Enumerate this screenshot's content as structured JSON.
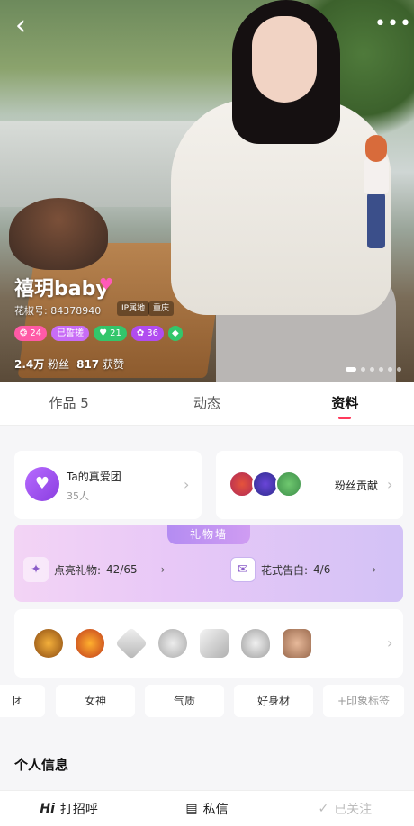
{
  "header": {
    "back_icon": "chevron-left-icon",
    "more_icon": "more-dots-icon"
  },
  "profile": {
    "nickname": "禧玥baby",
    "id_text": "花椒号: 84378940",
    "tags_small": [
      "IP属地",
      "重庆"
    ],
    "badges": [
      {
        "icon": "●",
        "text": "24",
        "color": "#ff5aa6"
      },
      {
        "icon": "",
        "text": "已誓搓",
        "color": "#c86cf6"
      },
      {
        "icon": "●",
        "text": "21",
        "color": "#33c66b"
      },
      {
        "icon": "●",
        "text": "36",
        "color": "#b14cf0"
      },
      {
        "icon": "●",
        "text": "",
        "color": "#33c66b"
      }
    ],
    "fans_count": "2.4万",
    "fans_label": "粉丝",
    "likes_count": "817",
    "likes_label": "获赞"
  },
  "tabs": [
    {
      "label": "作品 5"
    },
    {
      "label": "动态"
    },
    {
      "label": "资料"
    }
  ],
  "fan_club": {
    "title": "Ta的真爱团",
    "count": "35人"
  },
  "contributors": {
    "label": "粉丝贡献"
  },
  "gift_wall": {
    "title": "礼物墙",
    "light_label": "点亮礼物:",
    "light_value": "42/65",
    "confess_label": "花式告白:",
    "confess_value": "4/6"
  },
  "tags": [
    "团",
    "女神",
    "气质",
    "好身材",
    "+印象标签"
  ],
  "section": {
    "personal_info": "个人信息"
  },
  "bottom_bar": {
    "greet_prefix": "Hi",
    "greet": "打招呼",
    "message": "私信",
    "followed": "已关注"
  },
  "colors": {
    "accent": "#ff3a5c",
    "purple": "#a261ef"
  }
}
